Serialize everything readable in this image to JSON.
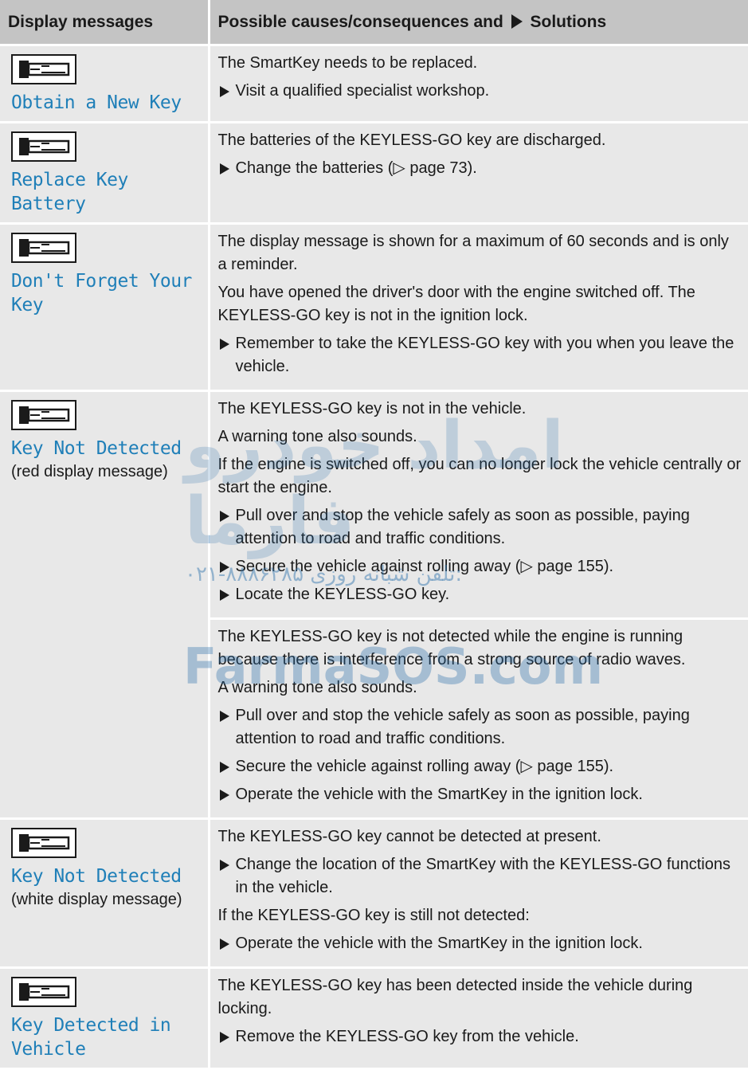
{
  "header": {
    "col1": "Display messages",
    "col2": "Possible causes/consequences and",
    "col2_suffix": "Solutions"
  },
  "rows": [
    {
      "icon": "key-icon",
      "title": "Obtain a New Key",
      "sub": "",
      "right": [
        {
          "type": "p",
          "text": "The SmartKey needs to be replaced."
        },
        {
          "type": "step",
          "text": "Visit a qualified specialist workshop."
        }
      ]
    },
    {
      "icon": "key-icon",
      "title": "Replace Key Battery",
      "sub": "",
      "right": [
        {
          "type": "p",
          "text": "The batteries of the KEYLESS-GO key are discharged."
        },
        {
          "type": "step",
          "text": "Change the batteries (▷ page 73)."
        }
      ]
    },
    {
      "icon": "key-icon",
      "title": "Don't Forget Your Key",
      "sub": "",
      "right": [
        {
          "type": "p",
          "text": "The display message is shown for a maximum of 60 seconds and is only a reminder."
        },
        {
          "type": "p",
          "text": "You have opened the driver's door with the engine switched off. The KEYLESS-GO key is not in the ignition lock."
        },
        {
          "type": "step",
          "text": "Remember to take the KEYLESS-GO key with you when you leave the vehicle."
        }
      ]
    },
    {
      "icon": "key-icon",
      "title": "Key Not Detected",
      "sub": "(red display message)",
      "right_a": [
        {
          "type": "p",
          "text": "The KEYLESS-GO key is not in the vehicle."
        },
        {
          "type": "p",
          "text": "A warning tone also sounds."
        },
        {
          "type": "p",
          "text": "If the engine is switched off, you can no longer lock the vehicle centrally or start the engine."
        },
        {
          "type": "step",
          "text": "Pull over and stop the vehicle safely as soon as possible, paying attention to road and traffic conditions."
        },
        {
          "type": "step",
          "text": "Secure the vehicle against rolling away (▷ page 155)."
        },
        {
          "type": "step",
          "text": "Locate the KEYLESS-GO key."
        }
      ],
      "right_b": [
        {
          "type": "p",
          "text": "The KEYLESS-GO key is not detected while the engine is running because there is interference from a strong source of radio waves."
        },
        {
          "type": "p",
          "text": "A warning tone also sounds."
        },
        {
          "type": "step",
          "text": "Pull over and stop the vehicle safely as soon as possible, paying attention to road and traffic conditions."
        },
        {
          "type": "step",
          "text": "Secure the vehicle against rolling away (▷ page 155)."
        },
        {
          "type": "step",
          "text": "Operate the vehicle with the SmartKey in the ignition lock."
        }
      ]
    },
    {
      "icon": "key-icon",
      "title": "Key Not Detected",
      "sub": "(white display message)",
      "right": [
        {
          "type": "p",
          "text": "The KEYLESS-GO key cannot be detected at present."
        },
        {
          "type": "step",
          "text": "Change the location of the SmartKey with the KEYLESS-GO functions in the vehicle."
        },
        {
          "type": "p",
          "text": "If the KEYLESS-GO key is still not detected:"
        },
        {
          "type": "step",
          "text": "Operate the vehicle with the SmartKey in the ignition lock."
        }
      ]
    },
    {
      "icon": "key-icon",
      "title": "Key Detected in Vehicle",
      "sub": "",
      "right": [
        {
          "type": "p",
          "text": "The KEYLESS-GO key has been detected inside the vehicle during locking."
        },
        {
          "type": "step",
          "text": "Remove the KEYLESS-GO key from the vehicle."
        }
      ]
    }
  ],
  "watermark": {
    "line1": "امداد خودرو فارما",
    "line2": "۰۲۱-۸۸۸۶۲۸۵ تلفن شبانه روزی:",
    "line3": "FarmaSOS.com"
  }
}
